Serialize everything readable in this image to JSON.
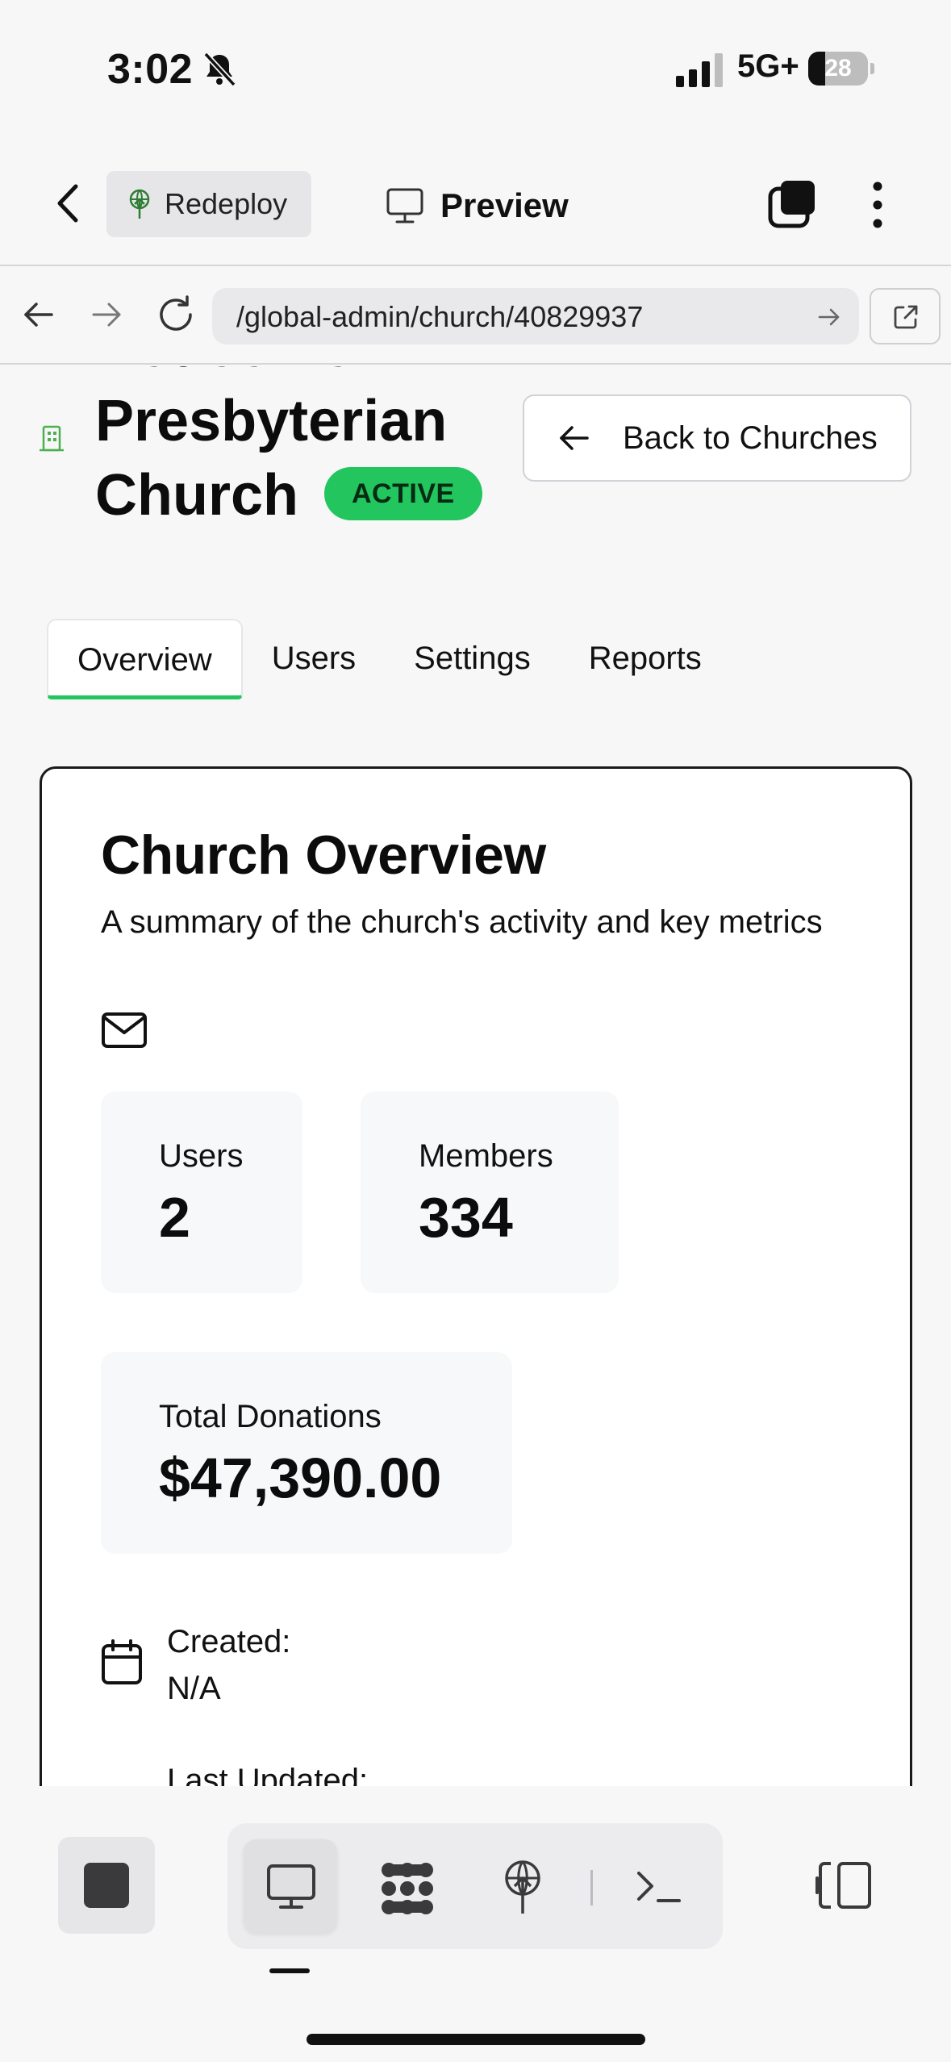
{
  "status_bar": {
    "time": "3:02",
    "network": "5G+",
    "battery_level": "28",
    "battery_fraction": 0.28,
    "icons": [
      "bell-muted-icon",
      "cellular-signal-icon",
      "battery-icon"
    ]
  },
  "app_header": {
    "redeploy_label": "Redeploy",
    "preview_label": "Preview",
    "icons": [
      "chevron-left-icon",
      "deploy-tower-icon",
      "monitor-icon",
      "layers-icon",
      "kebab-menu-icon"
    ]
  },
  "browser": {
    "url": "/global-admin/church/40829937",
    "icons": [
      "arrow-left-icon",
      "arrow-right-icon",
      "reload-icon",
      "go-arrow-icon",
      "open-external-icon"
    ]
  },
  "church": {
    "name": "Redeemer Presbyterian Church",
    "status": "ACTIVE",
    "back_button_label": "Back to Churches"
  },
  "tabs": [
    {
      "label": "Overview",
      "active": true
    },
    {
      "label": "Users",
      "active": false
    },
    {
      "label": "Settings",
      "active": false
    },
    {
      "label": "Reports",
      "active": false
    }
  ],
  "overview": {
    "title": "Church Overview",
    "subtitle": "A summary of the church's activity and key metrics",
    "stats": {
      "users": {
        "label": "Users",
        "value": "2"
      },
      "members": {
        "label": "Members",
        "value": "334"
      },
      "donations": {
        "label": "Total Donations",
        "value": "$47,390.00"
      }
    },
    "created_label": "Created:",
    "created_value": "N/A",
    "updated_label": "Last Updated:"
  },
  "bottom_toolbar": {
    "icons": [
      "stop-icon",
      "monitor-icon",
      "dots-grid-icon",
      "deploy-tower-icon",
      "terminal-icon",
      "panel-toggle-icon"
    ]
  },
  "colors": {
    "accent_green": "#22c55e",
    "background": "#f7f7f8",
    "text": "#111111"
  }
}
